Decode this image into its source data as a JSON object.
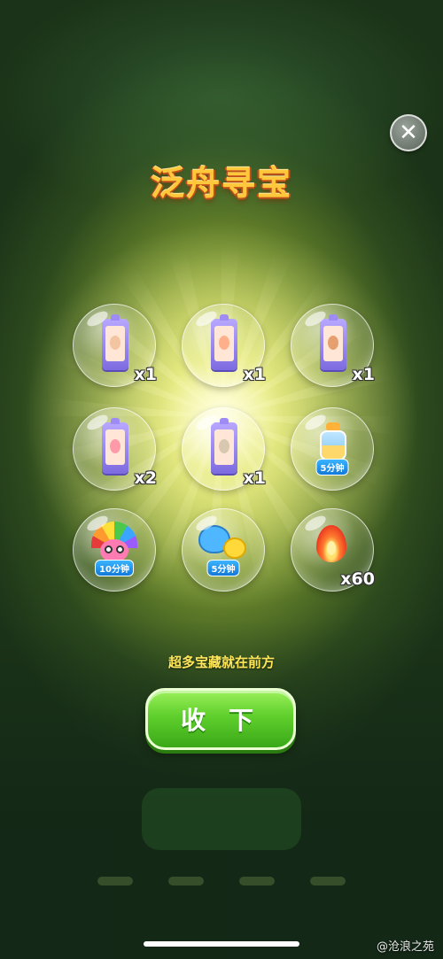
{
  "dialog": {
    "title": "泛舟寻宝",
    "close_icon": "close-icon",
    "rewards": [
      {
        "kind": "card",
        "qty": "x1",
        "color": "#f3c4a0"
      },
      {
        "kind": "card",
        "qty": "x1",
        "color": "#ffb08a"
      },
      {
        "kind": "card",
        "qty": "x1",
        "color": "#e6a070"
      },
      {
        "kind": "card",
        "qty": "x2",
        "color": "#ff9aa8"
      },
      {
        "kind": "card",
        "qty": "x1",
        "color": "#d8c8b0"
      },
      {
        "kind": "bottle",
        "badge": "5分钟"
      },
      {
        "kind": "owl-mask",
        "badge": "10分钟"
      },
      {
        "kind": "pets",
        "badge": "5分钟"
      },
      {
        "kind": "flame",
        "qty": "x60"
      }
    ],
    "subtitle": "超多宝藏就在前方",
    "collect_label": "收 下"
  },
  "watermark": "@沧浪之苑",
  "colors": {
    "title": "#ffc83a",
    "subtitle": "#ffe65a",
    "button": "#5fcf2c"
  }
}
